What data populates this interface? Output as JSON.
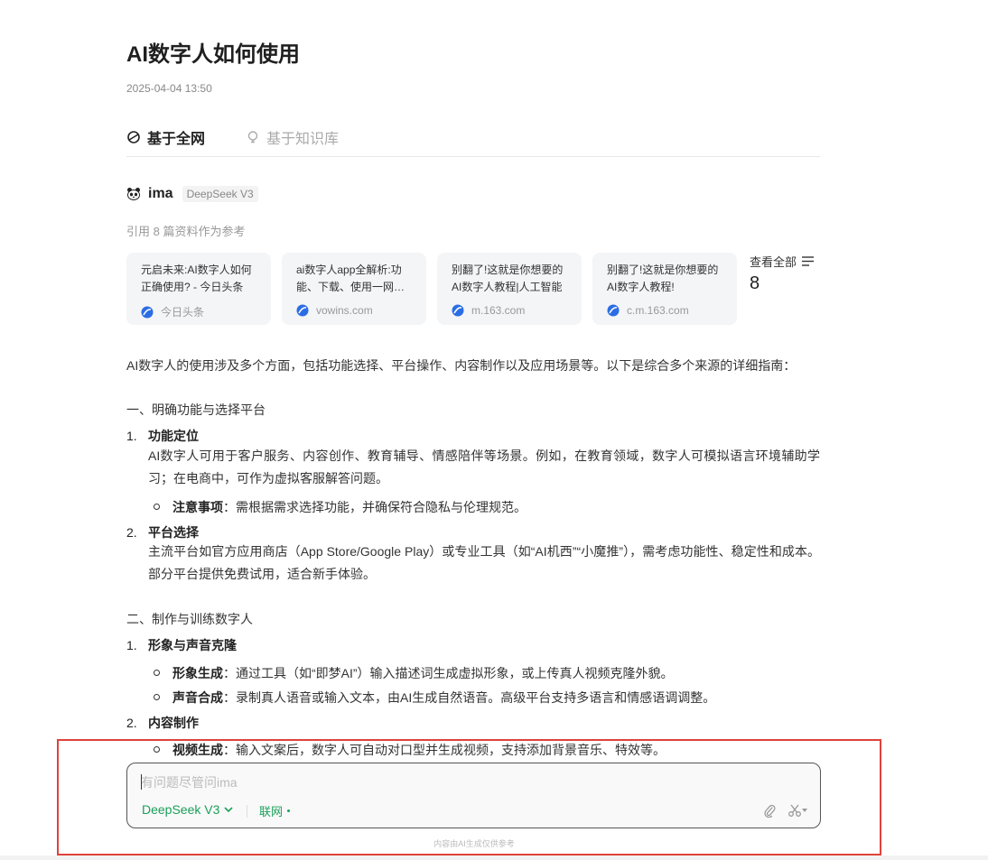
{
  "page": {
    "title": "AI数字人如何使用",
    "timestamp": "2025-04-04 13:50"
  },
  "tabs": [
    {
      "label": "基于全网",
      "active": true
    },
    {
      "label": "基于知识库",
      "active": false
    }
  ],
  "assistant": {
    "name": "ima",
    "model_tag": "DeepSeek V3",
    "refs_line": "引用 8 篇资料作为参考"
  },
  "sources": [
    {
      "title": "元启未来:AI数字人如何正确使用? - 今日头条",
      "site": "今日头条"
    },
    {
      "title": "ai数字人app全解析:功能、下载、使用一网打尽",
      "site": "vowins.com"
    },
    {
      "title": "别翻了!这就是你想要的AI数字人教程|人工智能",
      "site": "m.163.com"
    },
    {
      "title": "别翻了!这就是你想要的AI数字人教程!",
      "site": "c.m.163.com"
    }
  ],
  "view_all": {
    "label": "查看全部",
    "count": "8"
  },
  "answer": {
    "intro": "AI数字人的使用涉及多个方面，包括功能选择、平台操作、内容制作以及应用场景等。以下是综合多个来源的详细指南：",
    "section1": {
      "heading": "一、明确功能与选择平台",
      "item1": {
        "num": "1.",
        "label": "功能定位",
        "text": "AI数字人可用于客户服务、内容创作、教育辅导、情感陪伴等场景。例如，在教育领域，数字人可模拟语言环境辅助学习；在电商中，可作为虚拟客服解答问题。",
        "bullet_label": "注意事项",
        "bullet_text": "：需根据需求选择功能，并确保符合隐私与伦理规范。"
      },
      "item2": {
        "num": "2.",
        "label": "平台选择",
        "text": "主流平台如官方应用商店（App Store/Google Play）或专业工具（如“AI机西”“小魔推”），需考虑功能性、稳定性和成本。部分平台提供免费试用，适合新手体验。"
      }
    },
    "section2": {
      "heading": "二、制作与训练数字人",
      "item1": {
        "num": "1.",
        "label": "形象与声音克隆",
        "bullets": [
          {
            "label": "形象生成",
            "text": "：通过工具（如“即梦AI”）输入描述词生成虚拟形象，或上传真人视频克隆外貌。"
          },
          {
            "label": "声音合成",
            "text": "：录制真人语音或输入文本，由AI生成自然语音。高级平台支持多语言和情感语调调整。"
          }
        ]
      },
      "item2": {
        "num": "2.",
        "label": "内容制作",
        "bullets": [
          {
            "label": "视频生成",
            "text": "：输入文案后，数字人可自动对口型并生成视频，支持添加背景音乐、特效等。"
          }
        ]
      }
    }
  },
  "composer": {
    "placeholder": "有问题尽管问ima",
    "model": "DeepSeek V3",
    "web_toggle": "联网",
    "disclaimer": "内容由AI生成仅供参考"
  },
  "colors": {
    "accent_green": "#1aa05a",
    "source_blue": "#2b6de5",
    "highlight_red": "#e0423b"
  }
}
